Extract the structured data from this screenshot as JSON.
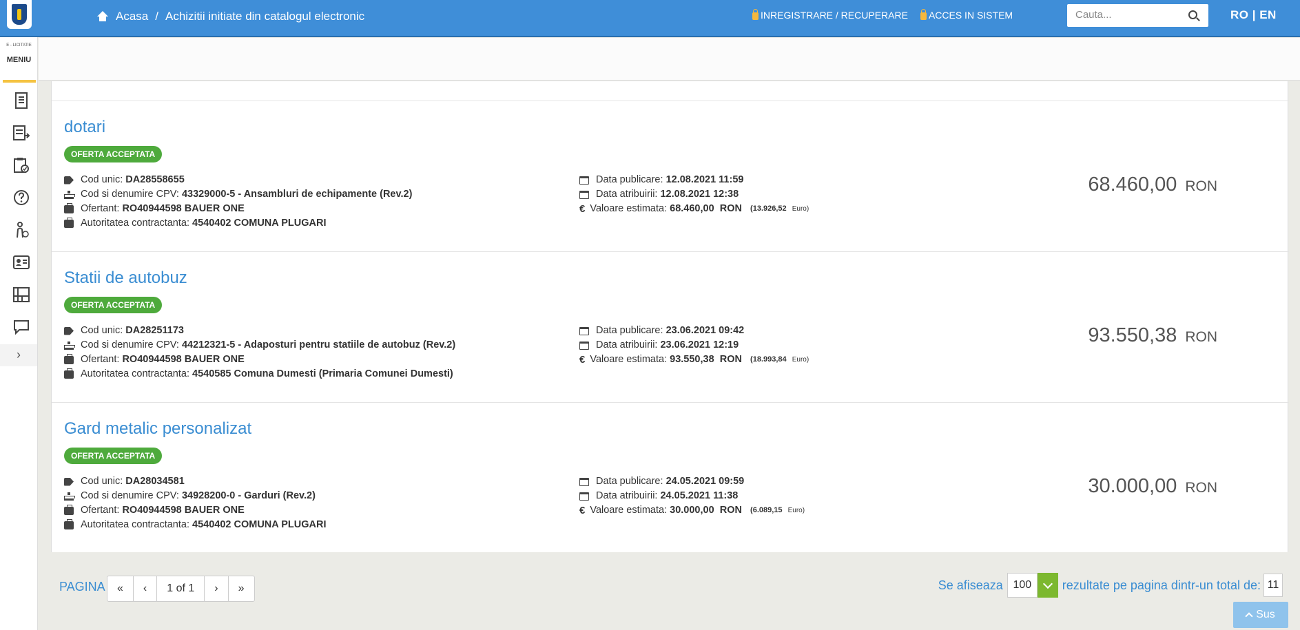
{
  "header": {
    "breadcrumb": [
      "Acasa",
      "/",
      "Achizitii initiate din catalogul electronic"
    ],
    "register_link": "INREGISTRARE / RECUPERARE",
    "login_link": "ACCES IN SISTEM",
    "search_placeholder": "Cauta...",
    "lang": "RO | EN"
  },
  "sidebar": {
    "brand": "E - LICITATIE",
    "menu_label": "MENIU",
    "toggle": "›",
    "items": [
      "document-icon",
      "list-arrow-icon",
      "clipboard-check-icon",
      "help-icon",
      "person-money-icon",
      "contact-card-icon",
      "calendar-grid-icon",
      "chat-icon"
    ]
  },
  "labels": {
    "cod_unic": "Cod unic:",
    "cpv": "Cod si denumire CPV:",
    "ofertant": "Ofertant:",
    "autoritate": "Autoritatea contractanta:",
    "data_publicare": "Data publicare:",
    "data_atribuirii": "Data atribuirii:",
    "valoare": "Valoare estimata:"
  },
  "items": [
    {
      "title": "dotari",
      "status": "OFERTA ACCEPTATA",
      "cod_unic": "DA28558655",
      "cpv": "43329000-5 - Ansambluri de echipamente (Rev.2)",
      "ofertant": "RO40944598 BAUER ONE",
      "autoritate": "4540402 COMUNA PLUGARI",
      "data_publicare": "12.08.2021 11:59",
      "data_atribuirii": "12.08.2021 12:38",
      "valoare": "68.460,00",
      "valoare_cur": "RON",
      "valoare_euro": "(13.926,52",
      "euro_label": "Euro)",
      "price": "68.460,00",
      "price_cur": "RON"
    },
    {
      "title": "Statii de autobuz",
      "status": "OFERTA ACCEPTATA",
      "cod_unic": "DA28251173",
      "cpv": "44212321-5 - Adaposturi pentru statiile de autobuz (Rev.2)",
      "ofertant": "RO40944598 BAUER ONE",
      "autoritate": "4540585 Comuna Dumesti (Primaria Comunei Dumesti)",
      "data_publicare": "23.06.2021 09:42",
      "data_atribuirii": "23.06.2021 12:19",
      "valoare": "93.550,38",
      "valoare_cur": "RON",
      "valoare_euro": "(18.993,84",
      "euro_label": "Euro)",
      "price": "93.550,38",
      "price_cur": "RON"
    },
    {
      "title": "Gard metalic personalizat",
      "status": "OFERTA ACCEPTATA",
      "cod_unic": "DA28034581",
      "cpv": "34928200-0 - Garduri (Rev.2)",
      "ofertant": "RO40944598 BAUER ONE",
      "autoritate": "4540402 COMUNA PLUGARI",
      "data_publicare": "24.05.2021 09:59",
      "data_atribuirii": "24.05.2021 11:38",
      "valoare": "30.000,00",
      "valoare_cur": "RON",
      "valoare_euro": "(6.089,15",
      "euro_label": "Euro)",
      "price": "30.000,00",
      "price_cur": "RON"
    }
  ],
  "pagination": {
    "label": "PAGINA",
    "first": "«",
    "prev": "‹",
    "current": "1 of 1",
    "next": "›",
    "last": "»",
    "showing_label": "Se afiseaza",
    "per_page": "100",
    "total_label": "rezultate pe pagina dintr-un total de:",
    "total": "11"
  },
  "top_button": "Sus",
  "colors": {
    "header_bg": "#3f8ed8",
    "title": "#3a8dd2",
    "badge": "#4eaa3c",
    "select_drop": "#7cb82f"
  }
}
